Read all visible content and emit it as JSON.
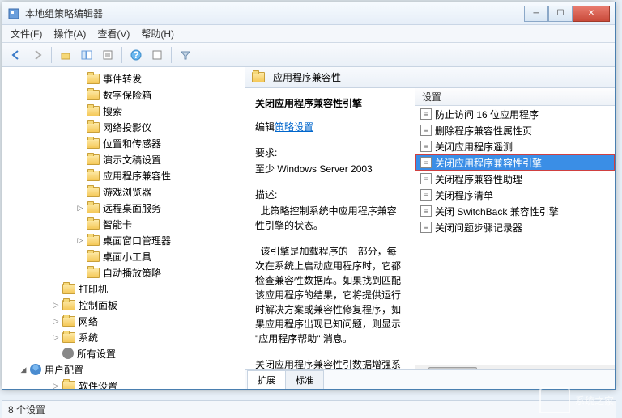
{
  "window": {
    "title": "本地组策略编辑器"
  },
  "menus": [
    "文件(F)",
    "操作(A)",
    "查看(V)",
    "帮助(H)"
  ],
  "tree": [
    {
      "lvl": 2,
      "label": "事件转发"
    },
    {
      "lvl": 2,
      "label": "数字保险箱"
    },
    {
      "lvl": 2,
      "label": "搜索"
    },
    {
      "lvl": 2,
      "label": "网络投影仪"
    },
    {
      "lvl": 2,
      "label": "位置和传感器"
    },
    {
      "lvl": 2,
      "label": "演示文稿设置"
    },
    {
      "lvl": 2,
      "label": "应用程序兼容性"
    },
    {
      "lvl": 2,
      "label": "游戏浏览器"
    },
    {
      "lvl": 2,
      "label": "远程桌面服务",
      "exp": "▷"
    },
    {
      "lvl": 2,
      "label": "智能卡"
    },
    {
      "lvl": 2,
      "label": "桌面窗口管理器",
      "exp": "▷"
    },
    {
      "lvl": 2,
      "label": "桌面小工具"
    },
    {
      "lvl": 2,
      "label": "自动播放策略"
    },
    {
      "lvl": 1,
      "label": "打印机"
    },
    {
      "lvl": 1,
      "label": "控制面板",
      "exp": "▷"
    },
    {
      "lvl": 1,
      "label": "网络",
      "exp": "▷"
    },
    {
      "lvl": 1,
      "label": "系统",
      "exp": "▷"
    },
    {
      "lvl": 1,
      "label": "所有设置",
      "icon": "gear"
    },
    {
      "lvl": 0,
      "label": "用户配置",
      "exp": "◢",
      "icon": "user"
    },
    {
      "lvl": 1,
      "label": "软件设置",
      "exp": "▷"
    }
  ],
  "right_header": "应用程序兼容性",
  "detail": {
    "title": "关闭应用程序兼容性引擎",
    "edit_prefix": "编辑",
    "edit_link": "策略设置",
    "req_label": "要求:",
    "req_value": "至少 Windows Server 2003",
    "desc_label": "描述:",
    "desc_p1": "  此策略控制系统中应用程序兼容性引擎的状态。",
    "desc_p2": "  该引擎是加载程序的一部分，每次在系统上启动应用程序时，它都检查兼容性数据库。如果找到匹配该应用程序的结果，它将提供运行时解决方案或兼容性修复程序，如果应用程序出现已知问题，则显示 \"应用程序帮助\" 消息。",
    "desc_p3": "关闭应用程序兼容性引数据增强系"
  },
  "list_header": "设置",
  "settings": [
    {
      "label": "防止访问 16 位应用程序"
    },
    {
      "label": "删除程序兼容性属性页"
    },
    {
      "label": "关闭应用程序遥测"
    },
    {
      "label": "关闭应用程序兼容性引擎",
      "selected": true
    },
    {
      "label": "关闭程序兼容性助理"
    },
    {
      "label": "关闭程序清单"
    },
    {
      "label": "关闭 SwitchBack 兼容性引擎"
    },
    {
      "label": "关闭问题步骤记录器"
    }
  ],
  "tabs": [
    "扩展",
    "标准"
  ],
  "status": "8 个设置",
  "watermark": "系统之家"
}
